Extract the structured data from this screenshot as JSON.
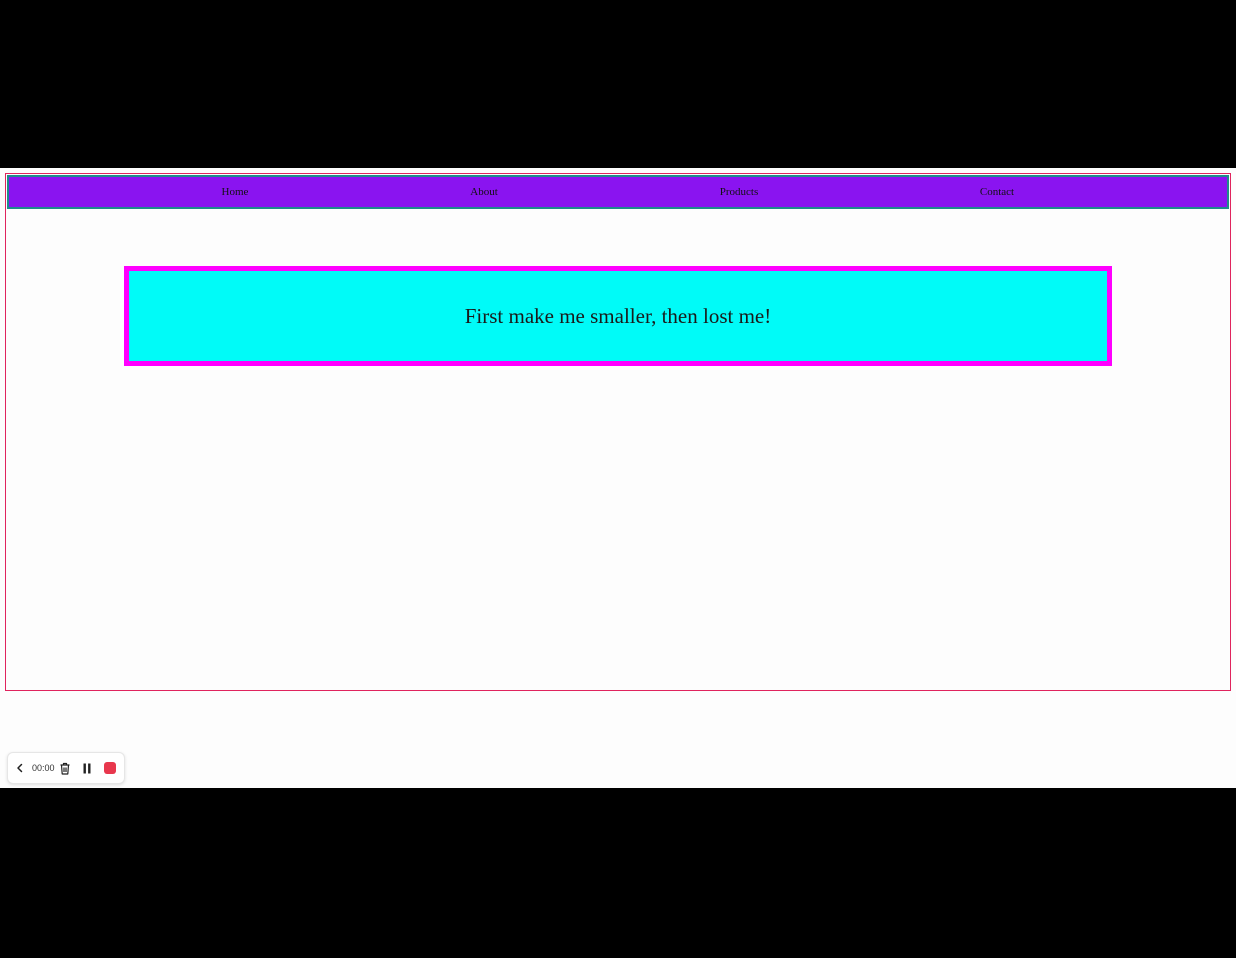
{
  "nav": {
    "items": [
      {
        "label": "Home"
      },
      {
        "label": "About"
      },
      {
        "label": "Products"
      },
      {
        "label": "Contact"
      }
    ]
  },
  "banner": {
    "text": "First make me smaller, then lost me!"
  },
  "recorder": {
    "time": "00:00",
    "icons": [
      "chevron-left-icon",
      "trash-icon",
      "pause-icon",
      "stop-icon"
    ]
  },
  "colors": {
    "nav_background": "#8a14f0",
    "nav_border": "#1e8c8c",
    "banner_background": "#00fbf8",
    "banner_border": "#ff00ff",
    "page_border": "#e0245e",
    "stop_button": "#e8374d"
  }
}
